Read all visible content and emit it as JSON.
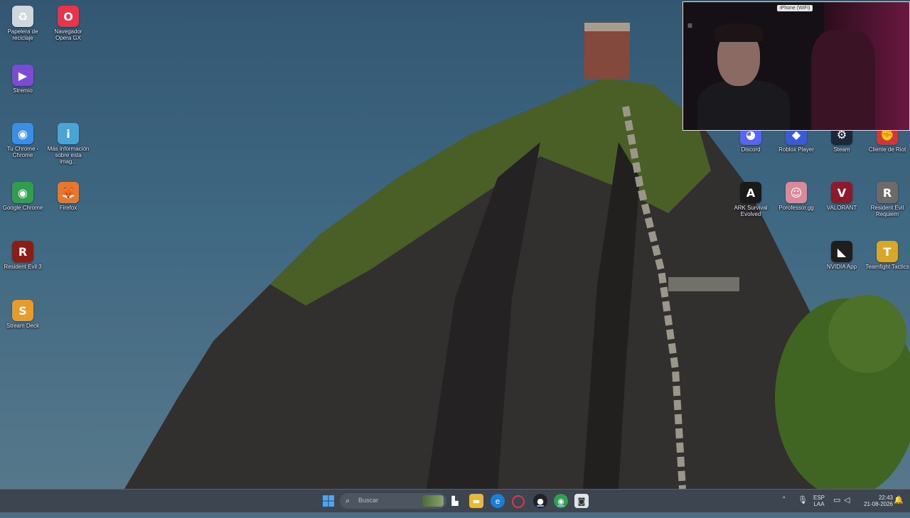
{
  "desktop_left": [
    {
      "name": "recycle-bin",
      "label": "Papelera de reciclaje",
      "icon": "recycle-bin-icon",
      "color": "#cfd6dc",
      "glyph": "♻"
    },
    {
      "name": "opera-gx",
      "label": "Navegador Opera GX",
      "icon": "opera-gx-icon",
      "color": "#e8334a",
      "glyph": "O"
    },
    {
      "name": "stremio",
      "label": "Stremio",
      "icon": "stremio-icon",
      "color": "#7b4bd6",
      "glyph": "▶"
    },
    {
      "name": "tu-chrome",
      "label": "Tu Chrome - Chrome",
      "icon": "chrome-profile-icon",
      "color": "#3a8ee6",
      "glyph": "◉"
    },
    {
      "name": "mas-informacion",
      "label": "Más información sobre esta imag...",
      "icon": "info-image-icon",
      "color": "#4ba3d8",
      "glyph": "i"
    },
    {
      "name": "google-chrome",
      "label": "Google Chrome",
      "icon": "chrome-icon",
      "color": "#2f9e4f",
      "glyph": "◉"
    },
    {
      "name": "firefox",
      "label": "Firefox",
      "icon": "firefox-icon",
      "color": "#e8772e",
      "glyph": "🦊"
    },
    {
      "name": "resident-evil-3",
      "label": "Resident Evil 3",
      "icon": "resident-evil-3-icon",
      "color": "#8a1e14",
      "glyph": "R"
    },
    {
      "name": "stream-deck",
      "label": "Stream Deck",
      "icon": "stream-deck-icon",
      "color": "#e89a2a",
      "glyph": "S"
    }
  ],
  "desktop_right": [
    {
      "name": "discord",
      "label": "Discord",
      "icon": "discord-icon",
      "color": "#5865f2",
      "glyph": "◕"
    },
    {
      "name": "roblox-player",
      "label": "Roblox Player",
      "icon": "roblox-icon",
      "color": "#3b5bd6",
      "glyph": "◆"
    },
    {
      "name": "steam",
      "label": "Steam",
      "icon": "steam-icon",
      "color": "#1b2838",
      "glyph": "⚙"
    },
    {
      "name": "cliente-riot",
      "label": "Cliente de Riot",
      "icon": "riot-icon",
      "color": "#d13639",
      "glyph": "✊"
    },
    {
      "name": "ark",
      "label": "ARK Survival Evolved",
      "icon": "ark-icon",
      "color": "#1a1a1a",
      "glyph": "A"
    },
    {
      "name": "porofessor",
      "label": "Porofessor.gg",
      "icon": "porofessor-icon",
      "color": "#d88a9a",
      "glyph": "☺"
    },
    {
      "name": "valorant",
      "label": "VALORANT",
      "icon": "valorant-icon",
      "color": "#8c1a2a",
      "glyph": "V"
    },
    {
      "name": "resident-evil-requiem",
      "label": "Resident Evil Requiem",
      "icon": "resident-evil-requiem-icon",
      "color": "#6f6a6a",
      "glyph": "R"
    },
    {
      "name": "nvidia-app",
      "label": "NVIDIA App",
      "icon": "nvidia-icon",
      "color": "#1e1e1e",
      "glyph": "◣"
    },
    {
      "name": "teamfight-tactics",
      "label": "Teamfight Tactics",
      "icon": "tft-icon",
      "color": "#d8a72a",
      "glyph": "T"
    }
  ],
  "webcam": {
    "source_tag": "iPhone (WiFi)"
  },
  "taskbar": {
    "search_placeholder": "Buscar",
    "language_top": "ESP",
    "language_bottom": "LAA",
    "time": "22:43",
    "date": "21-08-2026"
  }
}
